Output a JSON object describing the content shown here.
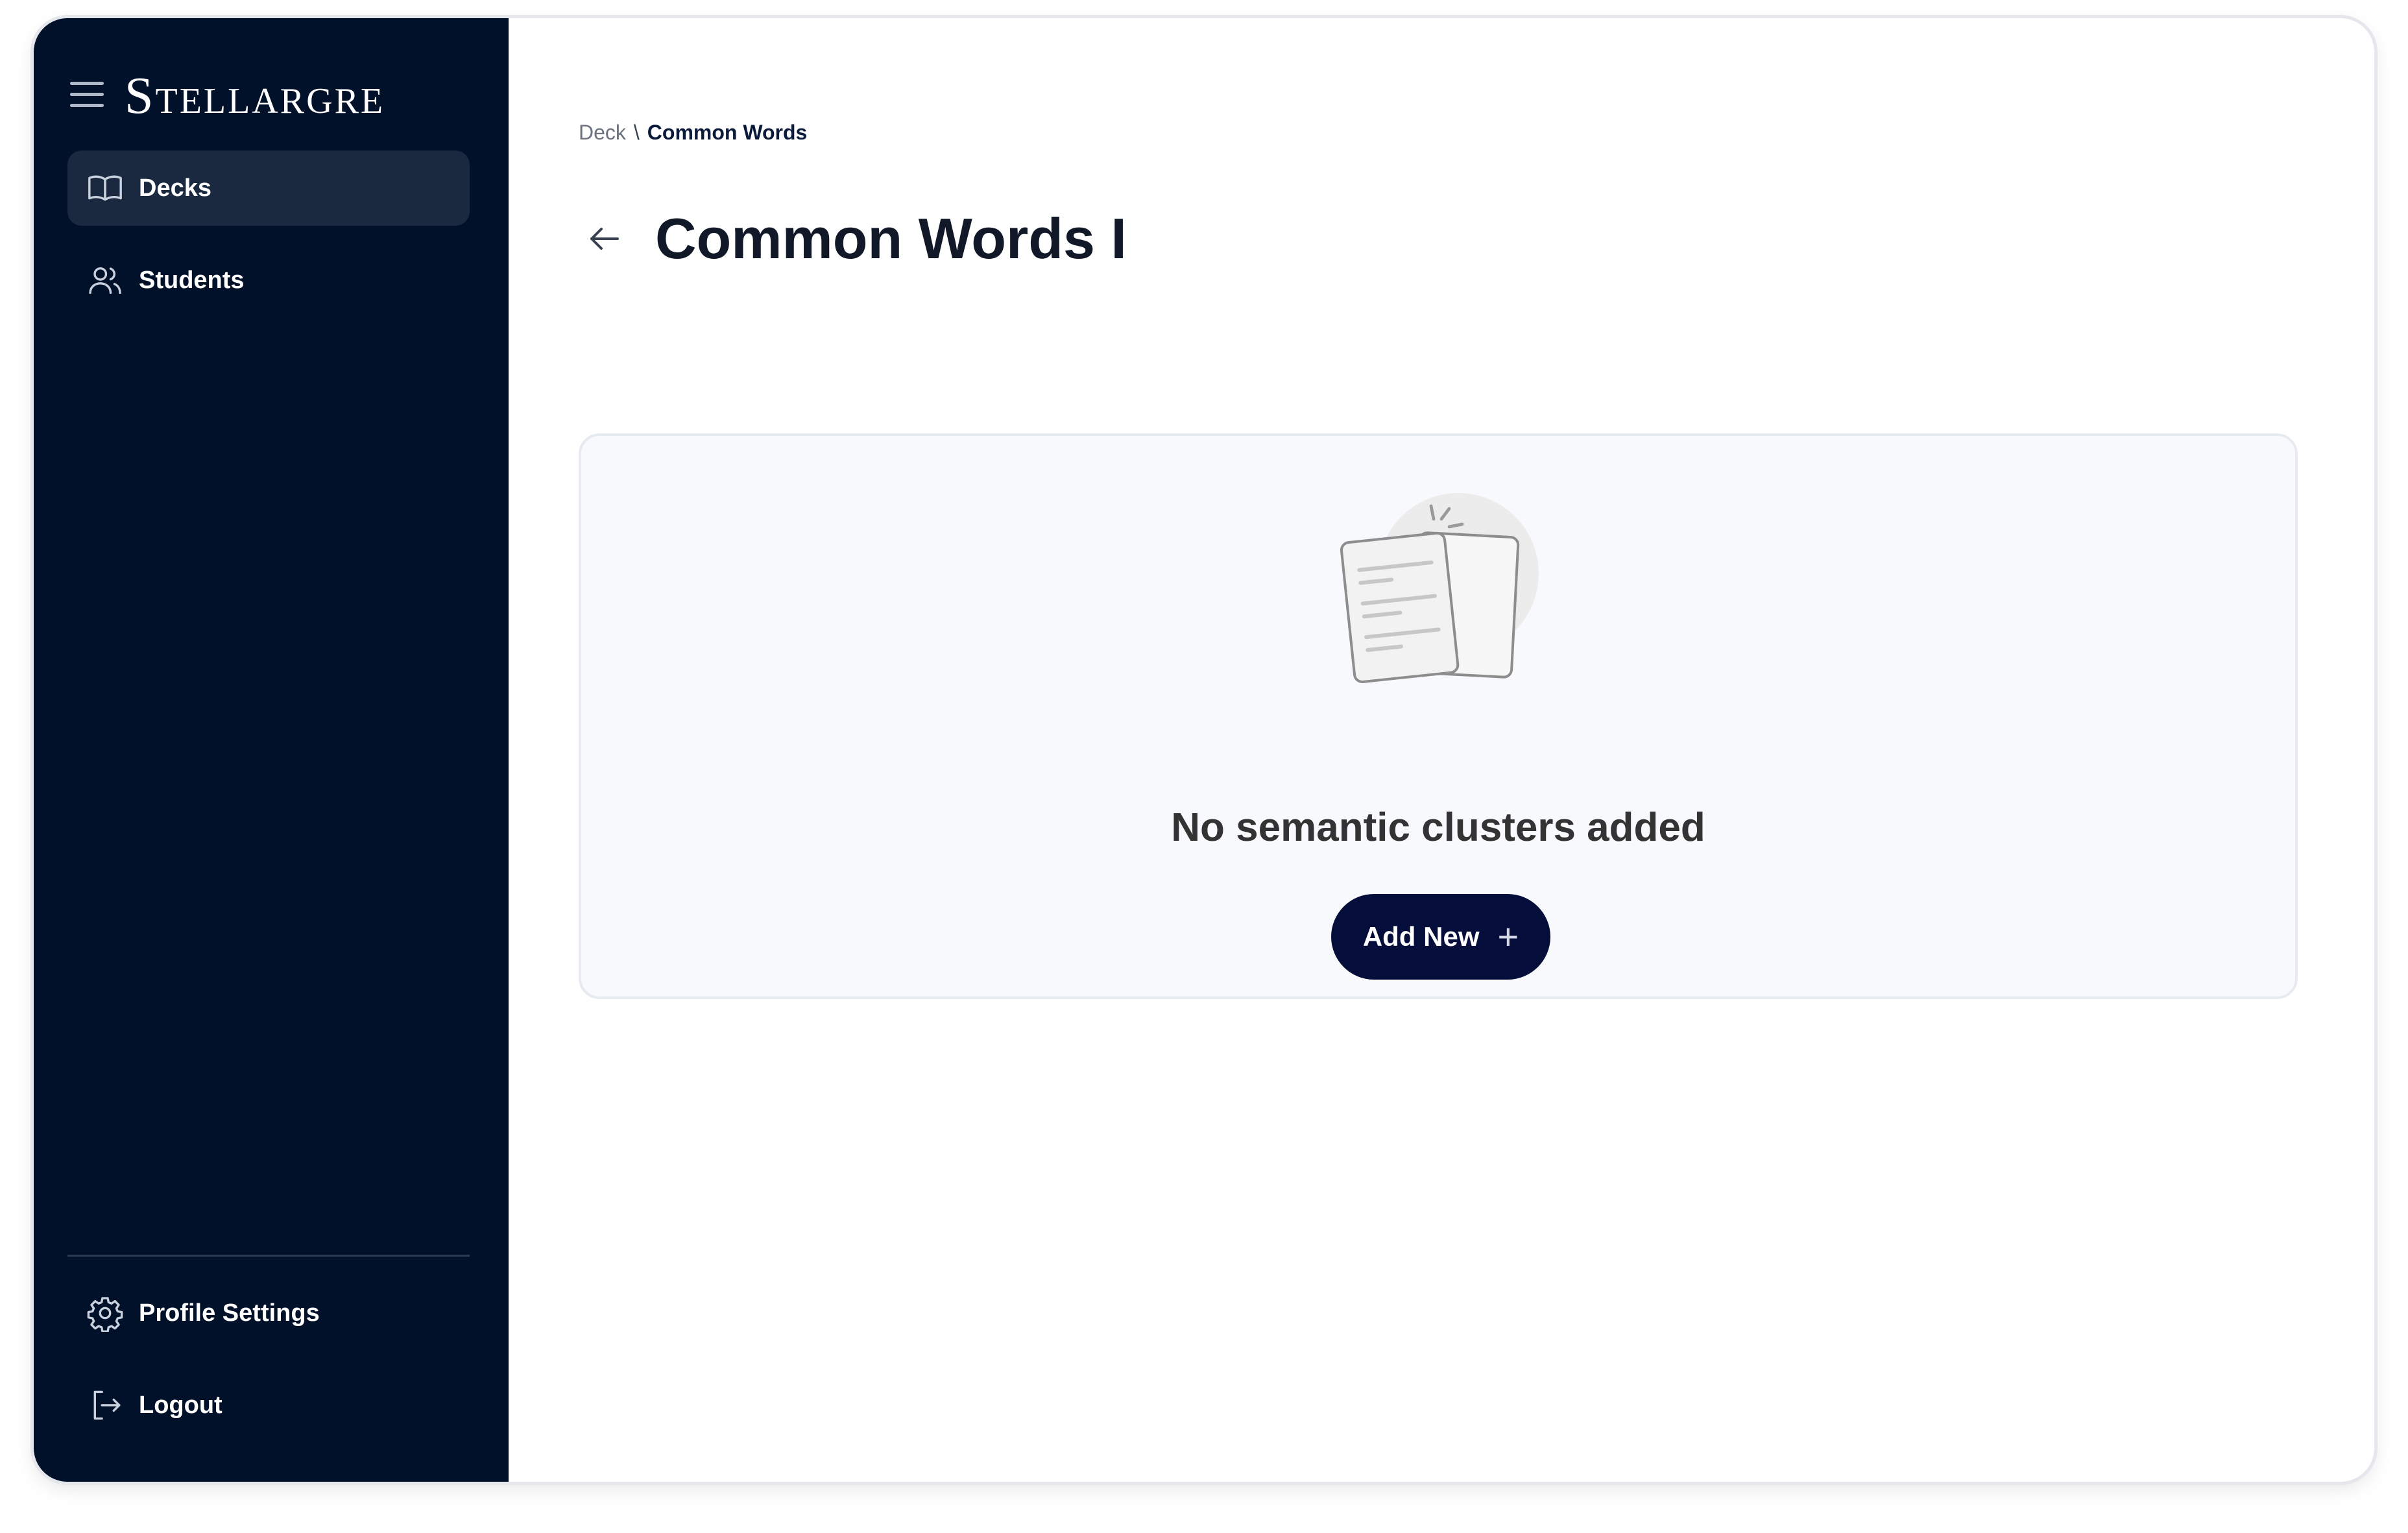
{
  "app": {
    "logo_text": "StellarGRE"
  },
  "sidebar": {
    "items": [
      {
        "label": "Decks",
        "icon": "book-open-icon",
        "active": true
      },
      {
        "label": "Students",
        "icon": "users-icon",
        "active": false
      }
    ],
    "footer_items": [
      {
        "label": "Profile Settings",
        "icon": "gear-icon"
      },
      {
        "label": "Logout",
        "icon": "logout-icon"
      }
    ]
  },
  "breadcrumb": {
    "parent": "Deck",
    "separator": "\\",
    "current": "Common Words"
  },
  "page": {
    "title": "Common Words I"
  },
  "empty_state": {
    "message": "No semantic clusters added",
    "button_label": "Add New",
    "illustration": "documents-illustration"
  },
  "colors": {
    "sidebar_bg": "#02112a",
    "active_item_bg": "#1a2940",
    "primary_button": "#050d3a",
    "card_bg": "#f7f9fc"
  }
}
